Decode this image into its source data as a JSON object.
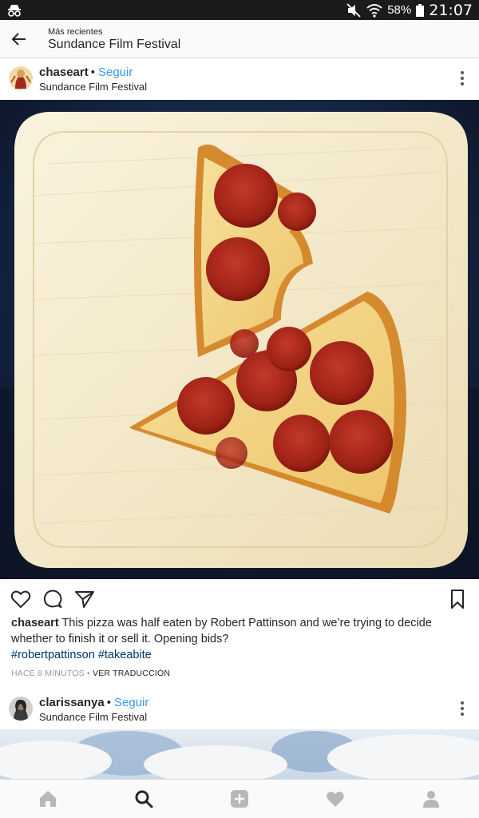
{
  "status_bar": {
    "battery": "58%",
    "time": "21:07",
    "icons": [
      "incognito-icon",
      "mute-icon",
      "wifi-icon",
      "battery-icon"
    ]
  },
  "header": {
    "subtitle": "Más recientes",
    "title": "Sundance Film Festival"
  },
  "post": {
    "username": "chaseart",
    "separator": "•",
    "follow_label": "Seguir",
    "location": "Sundance Film Festival",
    "caption_user": "chaseart",
    "caption_text": "This pizza was half eaten by Robert Pattinson and we’re trying to decide whether to finish it or sell it. Opening bids?",
    "hashtags": [
      "#robertpattinson",
      "#takeabite"
    ],
    "time_ago": "HACE 8 MINUTOS",
    "meta_separator": "•",
    "translate_label": "VER TRADUCCIÓN"
  },
  "next_post": {
    "username": "clarissanya",
    "separator": "•",
    "follow_label": "Seguir",
    "location": "Sundance Film Festival"
  },
  "bottom_nav": [
    "home-icon",
    "search-icon",
    "add-icon",
    "heart-icon",
    "profile-icon"
  ],
  "colors": {
    "link": "#3897f0",
    "hashtag": "#003569",
    "status_bar": "#1b1b1b",
    "bar_bg": "#fafafa",
    "border": "#dbdbdb"
  }
}
